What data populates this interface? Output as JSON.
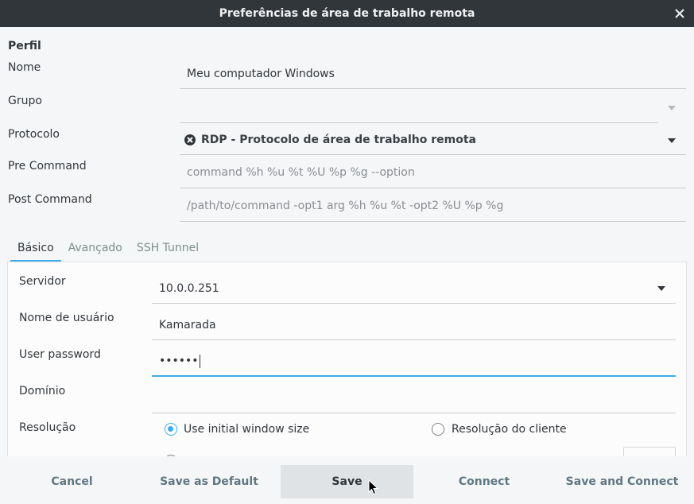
{
  "window": {
    "title": "Preferências de área de trabalho remota"
  },
  "profile": {
    "section_title": "Perfil",
    "name_label": "Nome",
    "name_value": "Meu computador Windows",
    "group_label": "Grupo",
    "group_value": "",
    "protocol_label": "Protocolo",
    "protocol_value": "RDP - Protocolo de área de trabalho remota",
    "precommand_label": "Pre Command",
    "precommand_placeholder": "command %h %u %t %U %p %g --option",
    "postcommand_label": "Post Command",
    "postcommand_placeholder": "/path/to/command -opt1 arg %h %u %t -opt2 %U %p %g"
  },
  "tabs": [
    {
      "label": "Básico",
      "active": true
    },
    {
      "label": "Avançado",
      "active": false
    },
    {
      "label": "SSH Tunnel",
      "active": false
    }
  ],
  "basic": {
    "server_label": "Servidor",
    "server_value": "10.0.0.251",
    "username_label": "Nome de usuário",
    "username_value": "Kamarada",
    "password_label": "User password",
    "password_value": "••••••",
    "domain_label": "Domínio",
    "domain_value": "",
    "resolution_label": "Resolução",
    "resolution_options": [
      {
        "label": "Use initial window size",
        "checked": true
      },
      {
        "label": "Resolução do cliente",
        "checked": false
      }
    ]
  },
  "footer": {
    "cancel": "Cancel",
    "save_default": "Save as Default",
    "save": "Save",
    "connect": "Connect",
    "save_connect": "Save and Connect"
  },
  "colors": {
    "accent": "#3daee9",
    "titlebar": "#31363b",
    "button_text": "#5f7782"
  }
}
